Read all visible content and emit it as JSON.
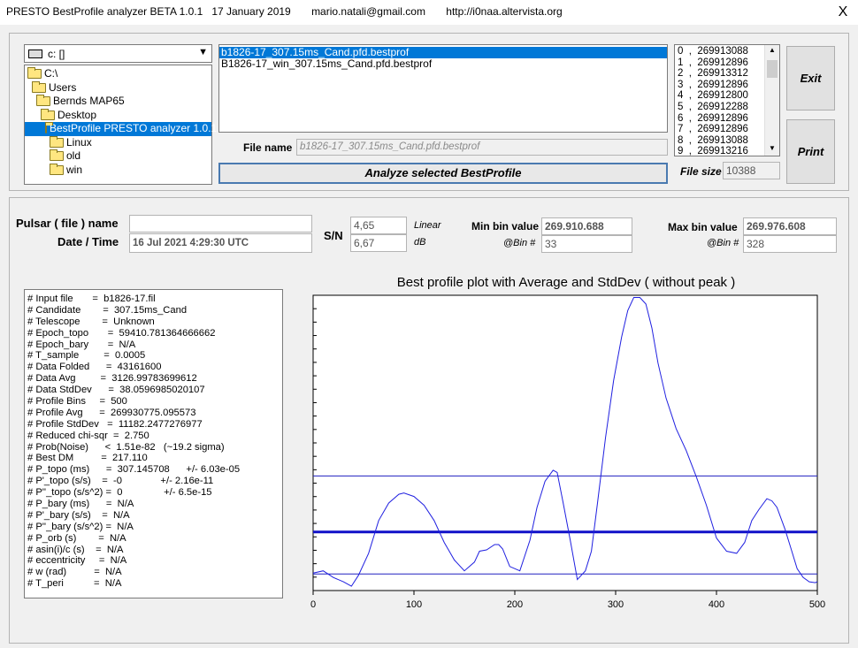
{
  "window": {
    "title": "PRESTO BestProfile analyzer BETA 1.0.1   17 January 2019       mario.natali@gmail.com       http://i0naa.altervista.org",
    "close": "X"
  },
  "drive": {
    "value": "c: []"
  },
  "dirs": [
    {
      "label": "C:\\",
      "level": 0,
      "selected": false
    },
    {
      "label": "Users",
      "level": 1,
      "selected": false
    },
    {
      "label": "Bernds MAP65",
      "level": 2,
      "selected": false
    },
    {
      "label": "Desktop",
      "level": 3,
      "selected": false
    },
    {
      "label": "BestProfile PRESTO analyzer 1.0.1.e",
      "level": 4,
      "selected": true
    },
    {
      "label": "Linux",
      "level": 5,
      "selected": false
    },
    {
      "label": "old",
      "level": 5,
      "selected": false
    },
    {
      "label": "win",
      "level": 5,
      "selected": false
    }
  ],
  "files": [
    {
      "name": "b1826-17_307.15ms_Cand.pfd.bestprof",
      "selected": true
    },
    {
      "name": "B1826-17_win_307.15ms_Cand.pfd.bestprof",
      "selected": false
    }
  ],
  "file_name": {
    "label": "File name",
    "value": "b1826-17_307.15ms_Cand.pfd.bestprof"
  },
  "analyze_button": "Analyze selected BestProfile",
  "file_size": {
    "label": "File size",
    "value": "10388"
  },
  "bin_values": [
    "0  ,  269913088",
    "1  ,  269912896",
    "2  ,  269913312",
    "3  ,  269912896",
    "4  ,  269912800",
    "5  ,  269912288",
    "6  ,  269912896",
    "7  ,  269912896",
    "8  ,  269913088",
    "9  ,  269913216"
  ],
  "buttons": {
    "exit": "Exit",
    "print": "Print"
  },
  "pulsar": {
    "name_label": "Pulsar ( file ) name",
    "name_value": "",
    "date_label": "Date / Time",
    "date_value": "16 Jul 2021      4:29:30   UTC"
  },
  "sn": {
    "label": "S/N",
    "linear_value": "4,65",
    "linear_label": "Linear",
    "db_value": "6,67",
    "db_label": "dB"
  },
  "min_bin": {
    "label": "Min bin value",
    "value": "269.910.688",
    "bin_label": "@Bin #",
    "bin": "33"
  },
  "max_bin": {
    "label": "Max bin value",
    "value": "269.976.608",
    "bin_label": "@Bin #",
    "bin": "328"
  },
  "info_lines": [
    "# Input file       =  b1826-17.fil",
    "# Candidate        =  307.15ms_Cand",
    "# Telescope        =  Unknown",
    "# Epoch_topo       =  59410.781364666662",
    "# Epoch_bary       =  N/A",
    "# T_sample         =  0.0005",
    "# Data Folded      =  43161600",
    "# Data Avg         =  3126.99783699612",
    "# Data StdDev      =  38.0596985020107",
    "# Profile Bins     =  500",
    "# Profile Avg      =  269930775.095573",
    "# Profile StdDev   =  11182.2477276977",
    "# Reduced chi-sqr  =  2.750",
    "# Prob(Noise)      <  1.51e-82   (~19.2 sigma)",
    "# Best DM          =  217.110",
    "# P_topo (ms)      =  307.145708      +/- 6.03e-05",
    "# P'_topo (s/s)    =  -0              +/- 2.16e-11",
    "# P''_topo (s/s^2) =  0               +/- 6.5e-15",
    "# P_bary (ms)      =  N/A",
    "# P'_bary (s/s)    =  N/A",
    "# P''_bary (s/s^2) =  N/A",
    "# P_orb (s)        =  N/A",
    "# asin(i)/c (s)    =  N/A",
    "# eccentricity     =  N/A",
    "# w (rad)          =  N/A",
    "# T_peri           =  N/A"
  ],
  "chart_data": {
    "type": "line",
    "title": "Best profile plot with  Average and StdDev ( without peak )",
    "xlim": [
      0,
      500
    ],
    "xticks": [
      0,
      100,
      200,
      300,
      400,
      500
    ],
    "ylim": [
      269910000,
      269977500
    ],
    "series": [
      {
        "role": "profile",
        "color": "#2020e0",
        "x": [
          0,
          10,
          20,
          30,
          38,
          45,
          55,
          65,
          75,
          85,
          90,
          100,
          110,
          120,
          130,
          140,
          150,
          160,
          165,
          172,
          180,
          184,
          188,
          195,
          205,
          215,
          222,
          230,
          238,
          242,
          248,
          255,
          262,
          270,
          276,
          282,
          290,
          298,
          306,
          312,
          318,
          324,
          330,
          336,
          342,
          350,
          360,
          370,
          380,
          390,
          400,
          410,
          420,
          428,
          435,
          442,
          450,
          455,
          460,
          468,
          474,
          480,
          486,
          492,
          498,
          500
        ],
        "y": [
          269914000,
          269914500,
          269913000,
          269912000,
          269911000,
          269913500,
          269918500,
          269926000,
          269930000,
          269932000,
          269932300,
          269931500,
          269929500,
          269926000,
          269921000,
          269917000,
          269914500,
          269916500,
          269919000,
          269919300,
          269920500,
          269920500,
          269919500,
          269915500,
          269914500,
          269921500,
          269929000,
          269935000,
          269937500,
          269937000,
          269930000,
          269921500,
          269912500,
          269914500,
          269919000,
          269930000,
          269945000,
          269958000,
          269968000,
          269974000,
          269977000,
          269977000,
          269975500,
          269970000,
          269962000,
          269954000,
          269947000,
          269942000,
          269936000,
          269929500,
          269922000,
          269919000,
          269918500,
          269921000,
          269926000,
          269928500,
          269931000,
          269930500,
          269929000,
          269924000,
          269919500,
          269915000,
          269913000,
          269912000,
          269911800,
          269912000
        ]
      }
    ],
    "average": 269923400,
    "stddev_upper": 269936200,
    "stddev_lower": 269913800
  }
}
